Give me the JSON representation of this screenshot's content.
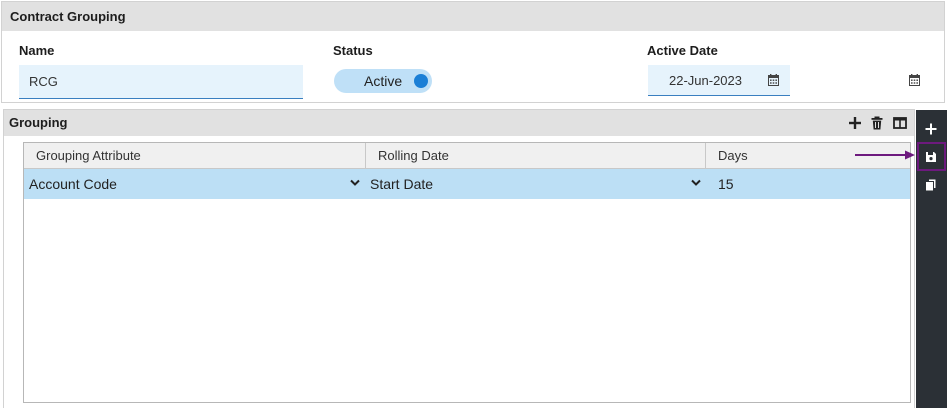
{
  "contract_grouping": {
    "title": "Contract Grouping",
    "name_label": "Name",
    "name_value": "RCG",
    "status_label": "Status",
    "status_value": "Active",
    "status_on": true,
    "active_date_label": "Active Date",
    "active_date_value": "22-Jun-2023"
  },
  "grouping": {
    "title": "Grouping",
    "toolbar_icons": [
      "add-icon",
      "delete-icon",
      "columns-icon"
    ],
    "columns": [
      "Grouping Attribute",
      "Rolling Date",
      "Days"
    ],
    "rows": [
      {
        "grouping_attribute": "Account Code",
        "rolling_date": "Start Date",
        "days": "15"
      }
    ]
  },
  "side_toolbar": {
    "icons": [
      "add-icon",
      "save-icon",
      "copy-icon"
    ],
    "highlighted": "save-icon"
  },
  "colors": {
    "header_bg": "#e1e1e1",
    "input_bg": "#e6f3fc",
    "selected_row": "#bcdff5",
    "toggle_knob": "#1b7fd6",
    "side_toolbar_bg": "#2b3036",
    "highlight": "#6d1a7e"
  }
}
